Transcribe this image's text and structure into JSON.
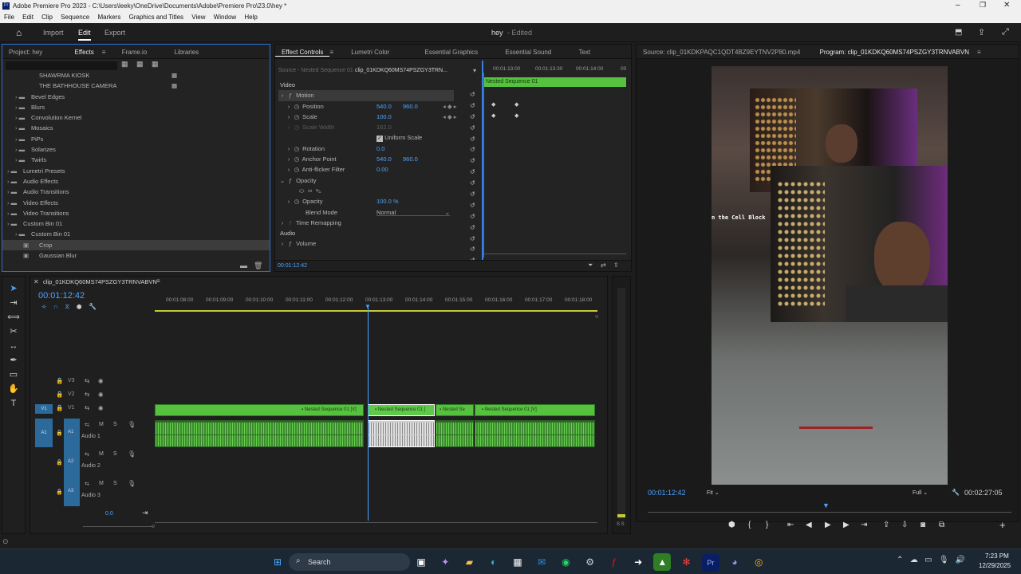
{
  "window": {
    "title": "Adobe Premiere Pro 2023 - C:\\Users\\leeky\\OneDrive\\Documents\\Adobe\\Premiere Pro\\23.0\\hey *"
  },
  "menu": [
    "File",
    "Edit",
    "Clip",
    "Sequence",
    "Markers",
    "Graphics and Titles",
    "View",
    "Window",
    "Help"
  ],
  "appbar": {
    "import": "Import",
    "edit": "Edit",
    "export": "Export",
    "project_name": "hey",
    "edited": "- Edited"
  },
  "left_tabs": {
    "project": "Project: hey",
    "effects": "Effects",
    "frameio": "Frame.io",
    "libraries": "Libraries"
  },
  "effects_tree": [
    {
      "label": "SHAWRMA KIOSK",
      "level": 2,
      "type": "preset"
    },
    {
      "label": "THE BATHHOUSE CAMERA",
      "level": 2,
      "type": "preset"
    },
    {
      "label": "Bevel Edges",
      "level": 1,
      "type": "folder"
    },
    {
      "label": "Blurs",
      "level": 1,
      "type": "folder"
    },
    {
      "label": "Convolution Kernel",
      "level": 1,
      "type": "folder"
    },
    {
      "label": "Mosaics",
      "level": 1,
      "type": "folder"
    },
    {
      "label": "PiPs",
      "level": 1,
      "type": "folder"
    },
    {
      "label": "Solarizes",
      "level": 1,
      "type": "folder"
    },
    {
      "label": "Twirls",
      "level": 1,
      "type": "folder"
    },
    {
      "label": "Lumetri Presets",
      "level": 0,
      "type": "folder"
    },
    {
      "label": "Audio Effects",
      "level": 0,
      "type": "folder"
    },
    {
      "label": "Audio Transitions",
      "level": 0,
      "type": "folder"
    },
    {
      "label": "Video Effects",
      "level": 0,
      "type": "folder"
    },
    {
      "label": "Video Transitions",
      "level": 0,
      "type": "folder"
    },
    {
      "label": "Custom Bin 01",
      "level": 0,
      "type": "folder"
    },
    {
      "label": "Custom Bin 01",
      "level": 1,
      "type": "folder"
    },
    {
      "label": "Crop",
      "level": 2,
      "type": "effect",
      "selected": true
    },
    {
      "label": "Gaussian Blur",
      "level": 2,
      "type": "effect"
    }
  ],
  "ec_tabs": {
    "effect_controls": "Effect Controls",
    "lumetri": "Lumetri Color",
    "essential_graphics": "Essential Graphics",
    "essential_sound": "Essential Sound",
    "text": "Text"
  },
  "ec": {
    "source": "Source - Nested Sequence 01",
    "clip": "clip_01KDKQ60MS74PSZGY3TRN...",
    "timecodes": [
      "00:01:13:00",
      "00:01:13:30",
      "00:01:14:00",
      "00"
    ],
    "nested_label": "Nested Sequence 01",
    "video": "Video",
    "motion": "Motion",
    "position": "Position",
    "pos_x": "540.0",
    "pos_y": "960.0",
    "scale": "Scale",
    "scale_v": "100.0",
    "scale_width": "Scale Width",
    "scale_width_v": "162.0",
    "uniform_scale": "Uniform Scale",
    "rotation": "Rotation",
    "rotation_v": "0.0",
    "anchor": "Anchor Point",
    "anchor_x": "540.0",
    "anchor_y": "960.0",
    "antiflicker": "Anti-flicker Filter",
    "antiflicker_v": "0.00",
    "opacity": "Opacity",
    "opacity_v": "100.0 %",
    "blend": "Blend Mode",
    "blend_v": "Normal",
    "time_remap": "Time Remapping",
    "audio": "Audio",
    "volume": "Volume",
    "current_tc": "00:01:12:42"
  },
  "source_tab": "Source: clip_01KDKPAQC1QDT4BZ9EYTNV2P80.mp4",
  "program_tab": "Program: clip_01KDKQ60MS74PSZGY3TRNVABVN",
  "program": {
    "tc": "00:01:12:42",
    "fit": "Fit",
    "full": "Full",
    "duration": "00:02:27:05",
    "overlay_text": "n the Cell Block"
  },
  "timeline": {
    "seq_name": "clip_01KDKQ60MS74PSZGY3TRNVABVN",
    "tc": "00:01:12:42",
    "ruler": [
      "00:01:08:00",
      "00:01:09:00",
      "00:01:10:00",
      "00:01:11:00",
      "00:01:12:00",
      "00:01:13:00",
      "00:01:14:00",
      "00:01:15:00",
      "00:01:16:00",
      "00:01:17:00",
      "00:01:18:00"
    ],
    "tracks_v": [
      "V3",
      "V2",
      "V1"
    ],
    "tracks_a": [
      "A1",
      "A2",
      "A3"
    ],
    "audio_names": [
      "Audio 1",
      "Audio 2",
      "Audio 3"
    ],
    "clips": [
      "Nested Sequence 01 [V]",
      "Nested Sequence 01 [",
      "Nested Se",
      "Nested Sequence 01 [V]"
    ],
    "master": "0.0",
    "meter": "S S"
  },
  "taskbar": {
    "search": "Search",
    "time": "7:23 PM",
    "date": "12/29/2025"
  }
}
